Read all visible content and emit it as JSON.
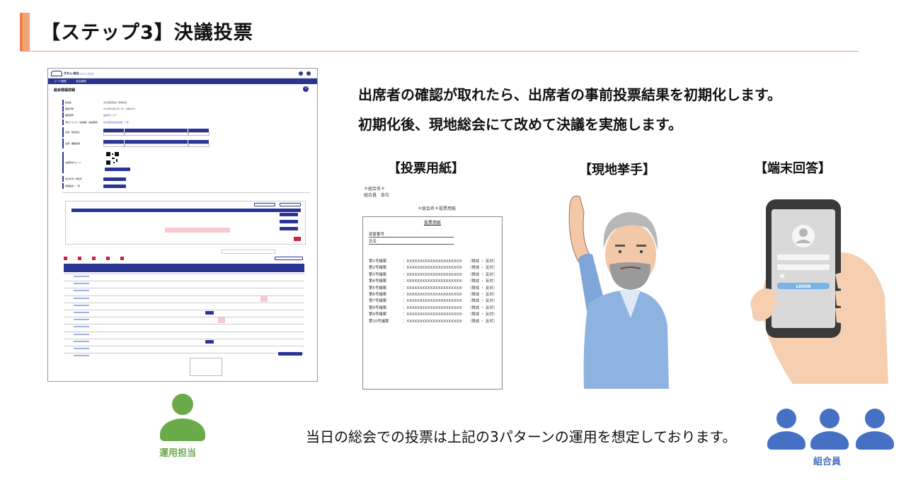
{
  "header": {
    "title": "【ステップ3】決議投票"
  },
  "app": {
    "brand": "ぎおん-総会",
    "brand_sub": "まちかど総会",
    "nav": [
      "コーナ管理",
      "総会管理"
    ],
    "page_title": "総会情報詳細",
    "help": "?",
    "fields": [
      {
        "label": "総会名",
        "value": "第4回定期総会（臨時総会）"
      },
      {
        "label": "開催日時",
        "value": "2023年06月30日（月）14時00分〜"
      },
      {
        "label": "開催場所",
        "value": "会議室センター"
      },
      {
        "label": "添付ファイル（議案書・決議事項）",
        "value": "第4回定期総会議案書（一括）"
      },
      {
        "label": "出席・総会成立",
        "value": ""
      },
      {
        "label": "出席・書面投票",
        "value": ""
      },
      {
        "label": "出席用QRコード",
        "value": ""
      },
      {
        "label": "出欠状況・委任状",
        "value": ""
      },
      {
        "label": "投票議案・一覧",
        "value": ""
      }
    ],
    "counts": {
      "a": "議案1",
      "b": "賛成",
      "c": "反対"
    }
  },
  "intro": {
    "line1": "出席者の確認が取れたら、出席者の事前投票結果を初期化します。",
    "line2": "初期化後、現地総会にて改めて決議を実施します。"
  },
  "methods": {
    "paper": "【投票用紙】",
    "hands": "【現地挙手】",
    "device": "【端末回答】"
  },
  "ballot": {
    "hdr1": "＊組合名＊",
    "hdr2": "組合員　各位",
    "hdr3": "＊総会名＊投票用紙",
    "title": "投票用紙",
    "field1": "部屋番号",
    "field2": "氏名",
    "rows": [
      {
        "label": "第1号議案",
        "text": "：XXXXXXXXXXXXXXXXXXXXXの件",
        "choice": "（賛成 ・ 反対）"
      },
      {
        "label": "第2号議案",
        "text": "：XXXXXXXXXXXXXXXXXXXXXの件",
        "choice": "（賛成 ・ 反対）"
      },
      {
        "label": "第3号議案",
        "text": "：XXXXXXXXXXXXXXXXXXXXXの件",
        "choice": "（賛成 ・ 反対）"
      },
      {
        "label": "第4号議案",
        "text": "：XXXXXXXXXXXXXXXXXXXXXの件",
        "choice": "（賛成 ・ 反対）"
      },
      {
        "label": "第5号議案",
        "text": "：XXXXXXXXXXXXXXXXXXXXXの件",
        "choice": "（賛成 ・ 反対）"
      },
      {
        "label": "第6号議案",
        "text": "：XXXXXXXXXXXXXXXXXXXXXの件",
        "choice": "（賛成 ・ 反対）"
      },
      {
        "label": "第7号議案",
        "text": "：XXXXXXXXXXXXXXXXXXXXXの件",
        "choice": "（賛成 ・ 反対）"
      },
      {
        "label": "第8号議案",
        "text": "：XXXXXXXXXXXXXXXXXXXXXの件",
        "choice": "（賛成 ・ 反対）"
      },
      {
        "label": "第9号議案",
        "text": "：XXXXXXXXXXXXXXXXXXXXXの件",
        "choice": "（賛成 ・ 反対）"
      },
      {
        "label": "第10号議案",
        "text": "：XXXXXXXXXXXXXXXXXXXXXの件",
        "choice": "（賛成 ・ 反対）"
      }
    ]
  },
  "phone": {
    "login": "LOGIN"
  },
  "roles": {
    "operator": "運用担当",
    "members": "組合員"
  },
  "note": "当日の総会での投票は上記の3パターンの運用を想定しております。",
  "colors": {
    "accent": "#f07f4a",
    "navy": "#2a3592",
    "operator_green": "#6aaa4a",
    "member_blue": "#4670c4"
  }
}
